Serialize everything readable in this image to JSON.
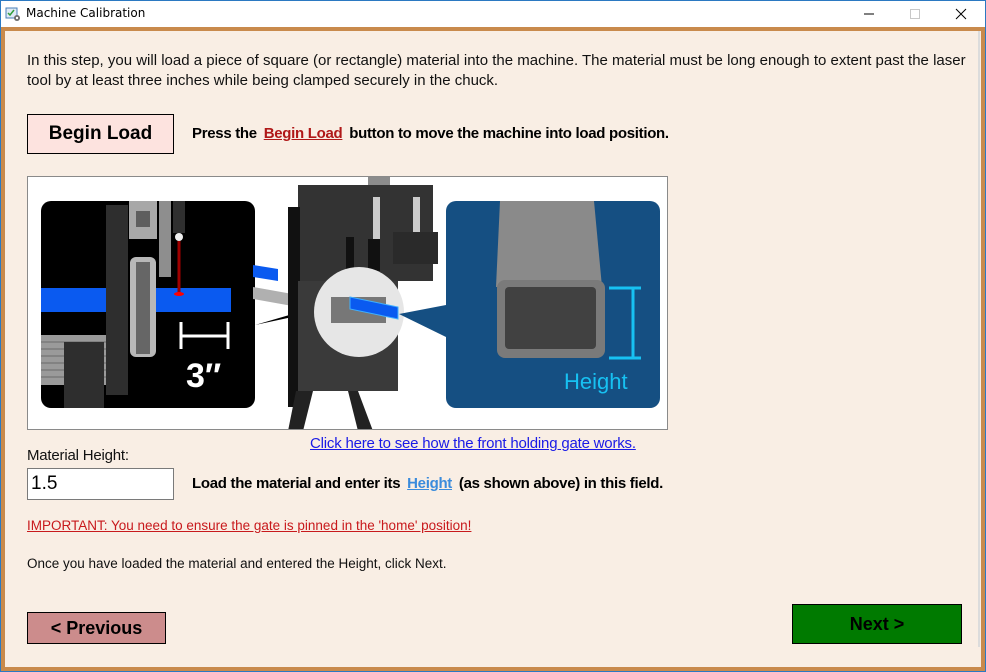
{
  "window": {
    "title": "Machine Calibration",
    "controls": {
      "minimize": "minimize",
      "maximize": "maximize",
      "close": "close"
    }
  },
  "intro_text": "In this step, you will load a piece of square (or rectangle) material into the machine. The material must be long enough to extent past the laser tool by at least three inches while being clamped securely in the chuck.",
  "begin_load": {
    "button_label": "Begin Load",
    "instruction_prefix": "Press the",
    "instruction_link": "Begin Load",
    "instruction_suffix": "button to move the machine into load position."
  },
  "illustration": {
    "left_panel_label": "3″",
    "right_panel_label": "Height",
    "colors": {
      "material_blue": "#0a5af0",
      "panel_blue": "#154f82",
      "height_cyan": "#17c1f2",
      "laser_red": "#b00000"
    }
  },
  "gate_link": "Click here to see how the front holding gate works.",
  "material_height": {
    "label": "Material Height:",
    "value": "1.5",
    "instruction_prefix": "Load the material and enter its",
    "instruction_link": "Height",
    "instruction_suffix": "(as shown above) in this field."
  },
  "important_notice": "IMPORTANT: You need to ensure the gate is pinned in the 'home' position!",
  "final_instruction": "Once you have loaded the material and entered the Height, click Next.",
  "navigation": {
    "previous_label": "< Previous",
    "next_label": "Next >"
  },
  "colors": {
    "background": "#f9eee4",
    "frame": "#c98a4c",
    "begin_load_bg": "#fde3df",
    "previous_bg": "#cc8c8c",
    "next_bg": "#007a00",
    "important_red": "#c8191c",
    "link_blue": "#1a1ae6"
  }
}
